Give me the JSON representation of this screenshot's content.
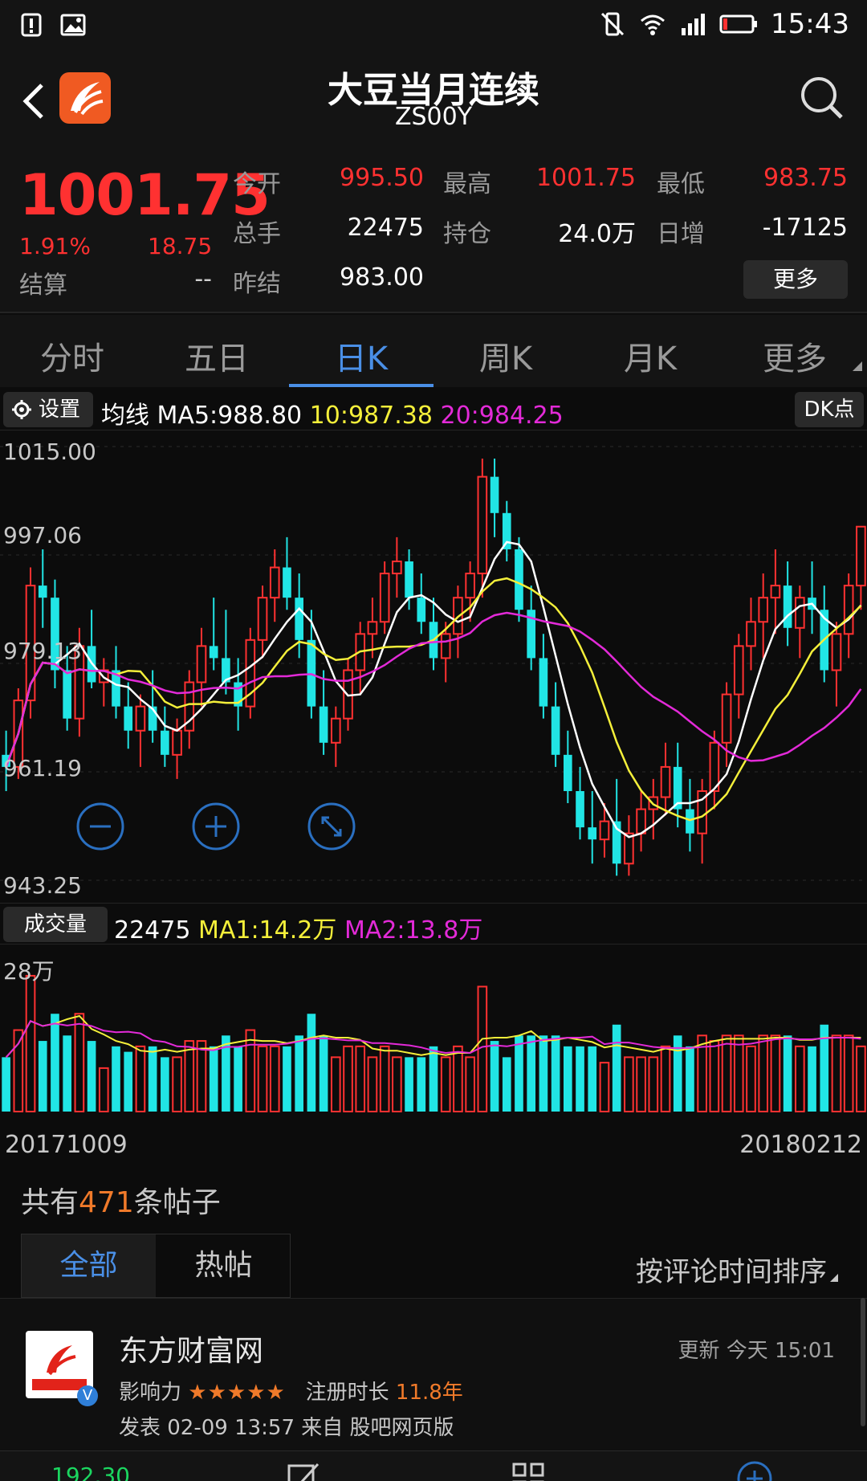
{
  "status": {
    "time": "15:43"
  },
  "header": {
    "title": "大豆当月连续",
    "code": "ZS00Y"
  },
  "quote": {
    "price": "1001.75",
    "pct": "1.91%",
    "change": "18.75",
    "settle_label": "结算",
    "settle_value": "--",
    "open_label": "今开",
    "open_value": "995.50",
    "high_label": "最高",
    "high_value": "1001.75",
    "low_label": "最低",
    "low_value": "983.75",
    "volume_label": "总手",
    "volume_value": "22475",
    "oi_label": "持仓",
    "oi_value": "24.0万",
    "daily_inc_label": "日增",
    "daily_inc_value": "-17125",
    "prev_settle_label": "昨结",
    "prev_settle_value": "983.00",
    "more_label": "更多"
  },
  "tabs": [
    "分时",
    "五日",
    "日K",
    "周K",
    "月K",
    "更多"
  ],
  "mabar": {
    "settings_label": "设置",
    "ma_label": "均线",
    "ma5": "MA5:988.80",
    "ma10": "10:987.38",
    "ma20": "20:984.25",
    "dk_label": "DK点"
  },
  "chart_labels": {
    "y1": "1015.00",
    "y2": "997.06",
    "y3": "979.13",
    "y4": "961.19",
    "y5": "943.25"
  },
  "volume": {
    "label": "成交量",
    "value": "22475",
    "ma1": "MA1:14.2万",
    "ma2": "MA2:13.8万",
    "max_label": "28万"
  },
  "dates": {
    "start": "20171009",
    "end": "20180212"
  },
  "posts": {
    "prefix": "共有",
    "count": "471",
    "suffix": "条帖子",
    "tab_all": "全部",
    "tab_hot": "热帖",
    "sort": "按评论时间排序"
  },
  "post": {
    "author": "东方财富网",
    "update": "更新 今天 15:01",
    "influence_label": "影响力",
    "stars": "★★★★★",
    "reg_label": "注册时长",
    "reg_years": "11.8年",
    "meta": "发表 02-09 13:57    来自 股吧网页版"
  },
  "bottomnav": {
    "price": "192.30"
  },
  "colors": {
    "up": "#ff3131",
    "down": "#21e5e5",
    "accent": "#4a8fe6",
    "ma5": "#ffffff",
    "ma10": "#f4ef3a",
    "ma20": "#e32ad8"
  },
  "chart_data": [
    {
      "type": "candlestick",
      "title": "日K",
      "y_ticks": [
        1015.0,
        997.06,
        979.13,
        961.19,
        943.25
      ],
      "ylim": [
        943.25,
        1015.0
      ],
      "x_range": [
        "20171009",
        "20180212"
      ],
      "series": [
        {
          "name": "MA5",
          "last": 988.8
        },
        {
          "name": "10",
          "last": 987.38
        },
        {
          "name": "20",
          "last": 984.25
        }
      ],
      "candles": [
        [
          964,
          968,
          958,
          962
        ],
        [
          962,
          975,
          960,
          973
        ],
        [
          973,
          995,
          970,
          992
        ],
        [
          992,
          998,
          985,
          990
        ],
        [
          990,
          993,
          975,
          978
        ],
        [
          978,
          982,
          968,
          970
        ],
        [
          970,
          985,
          967,
          982
        ],
        [
          982,
          988,
          975,
          976
        ],
        [
          976,
          980,
          972,
          978
        ],
        [
          978,
          982,
          970,
          972
        ],
        [
          972,
          976,
          965,
          968
        ],
        [
          968,
          974,
          962,
          972
        ],
        [
          972,
          978,
          966,
          968
        ],
        [
          968,
          972,
          962,
          964
        ],
        [
          964,
          970,
          960,
          968
        ],
        [
          968,
          978,
          965,
          976
        ],
        [
          976,
          985,
          972,
          982
        ],
        [
          982,
          990,
          978,
          980
        ],
        [
          980,
          988,
          974,
          976
        ],
        [
          976,
          980,
          968,
          972
        ],
        [
          972,
          985,
          970,
          983
        ],
        [
          983,
          992,
          980,
          990
        ],
        [
          990,
          998,
          986,
          995
        ],
        [
          995,
          1000,
          988,
          990
        ],
        [
          990,
          994,
          980,
          983
        ],
        [
          983,
          988,
          970,
          972
        ],
        [
          972,
          978,
          964,
          966
        ],
        [
          966,
          972,
          962,
          970
        ],
        [
          970,
          980,
          968,
          978
        ],
        [
          978,
          986,
          974,
          984
        ],
        [
          984,
          990,
          980,
          986
        ],
        [
          986,
          996,
          984,
          994
        ],
        [
          994,
          1000,
          990,
          996
        ],
        [
          996,
          998,
          988,
          990
        ],
        [
          990,
          994,
          984,
          986
        ],
        [
          986,
          990,
          978,
          980
        ],
        [
          980,
          986,
          976,
          984
        ],
        [
          984,
          992,
          980,
          990
        ],
        [
          990,
          996,
          986,
          994
        ],
        [
          994,
          1013,
          990,
          1010
        ],
        [
          1010,
          1013,
          1000,
          1004
        ],
        [
          1004,
          1006,
          996,
          998
        ],
        [
          998,
          1000,
          986,
          988
        ],
        [
          988,
          992,
          978,
          980
        ],
        [
          980,
          984,
          970,
          972
        ],
        [
          972,
          976,
          962,
          964
        ],
        [
          964,
          968,
          956,
          958
        ],
        [
          958,
          962,
          950,
          952
        ],
        [
          952,
          958,
          946,
          950
        ],
        [
          950,
          956,
          947,
          953
        ],
        [
          953,
          960,
          944,
          946
        ],
        [
          946,
          954,
          944,
          951
        ],
        [
          951,
          958,
          948,
          955
        ],
        [
          955,
          960,
          950,
          957
        ],
        [
          957,
          966,
          954,
          962
        ],
        [
          962,
          966,
          952,
          955
        ],
        [
          955,
          960,
          948,
          951
        ],
        [
          951,
          960,
          946,
          958
        ],
        [
          958,
          968,
          955,
          966
        ],
        [
          966,
          976,
          962,
          974
        ],
        [
          974,
          984,
          970,
          982
        ],
        [
          982,
          990,
          978,
          986
        ],
        [
          986,
          994,
          980,
          990
        ],
        [
          990,
          998,
          984,
          992
        ],
        [
          992,
          996,
          982,
          985
        ],
        [
          985,
          992,
          980,
          990
        ],
        [
          990,
          996,
          984,
          988
        ],
        [
          988,
          992,
          976,
          978
        ],
        [
          978,
          986,
          972,
          984
        ],
        [
          984,
          994,
          980,
          992
        ],
        [
          992,
          1000,
          988,
          1001.75
        ]
      ]
    },
    {
      "type": "bar",
      "title": "成交量",
      "ylabel": "28万",
      "series": [
        {
          "name": "MA1",
          "last": "14.2万"
        },
        {
          "name": "MA2",
          "last": "13.8万"
        }
      ]
    }
  ]
}
